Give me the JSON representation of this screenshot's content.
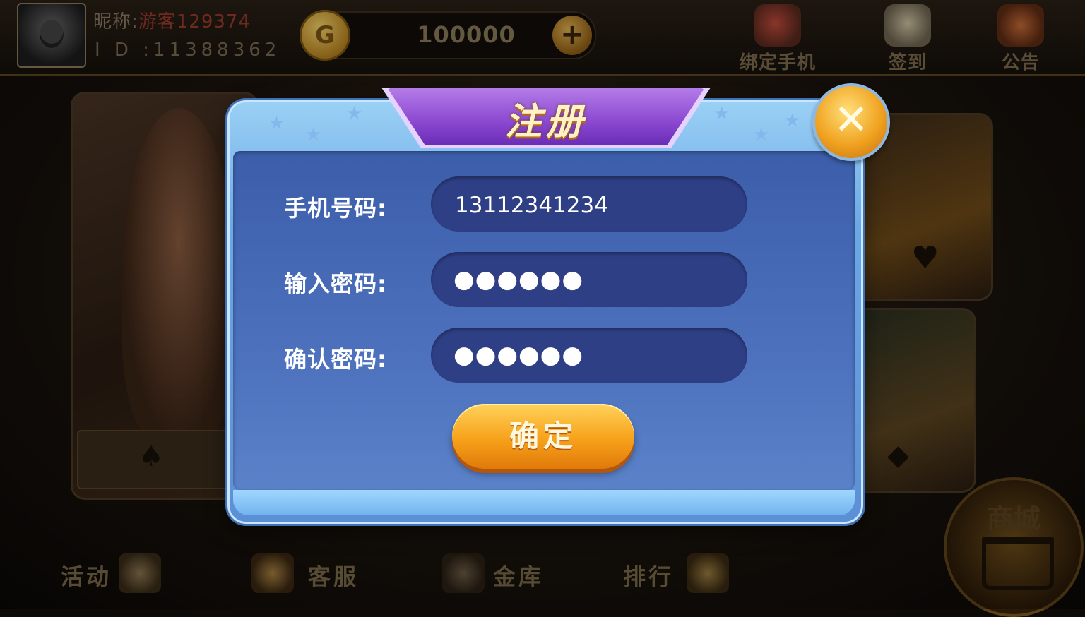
{
  "user": {
    "nickname_label": "昵称:",
    "nickname": "游客129374",
    "id_label": "I D :",
    "id": "11388362",
    "coins": "100000"
  },
  "top_actions": [
    {
      "label": "绑定手机",
      "icon": "phone-gift-icon"
    },
    {
      "label": "签到",
      "icon": "gift-calendar-icon"
    },
    {
      "label": "公告",
      "icon": "megaphone-icon"
    }
  ],
  "dialog": {
    "title": "注册",
    "fields": [
      {
        "label": "手机号码:",
        "value": "13112341234",
        "type": "text"
      },
      {
        "label": "输入密码:",
        "value": "●●●●●●",
        "type": "password"
      },
      {
        "label": "确认密码:",
        "value": "●●●●●●",
        "type": "password"
      }
    ],
    "confirm_label": "确定"
  },
  "bottom_nav": [
    {
      "label": "活动",
      "icon": "handshake-icon"
    },
    {
      "label": "客服",
      "icon": "customer-service-icon"
    },
    {
      "label": "金库",
      "icon": "safe-icon"
    },
    {
      "label": "排行",
      "icon": "coins-rank-icon"
    }
  ],
  "shop_label": "商城",
  "colors": {
    "dialog_blue": "#5c8fd6",
    "title_purple": "#8a48d0",
    "confirm_orange": "#f7a11a",
    "field_bg": "#2e3f85"
  }
}
